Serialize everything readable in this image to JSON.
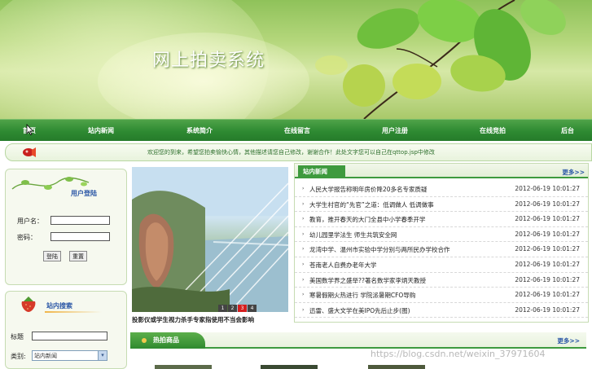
{
  "banner": {
    "title": "网上拍卖系统"
  },
  "nav": {
    "items": [
      {
        "label": "首页"
      },
      {
        "label": "站内新闻"
      },
      {
        "label": "系统简介"
      },
      {
        "label": "在线留言"
      },
      {
        "label": "用户注册"
      },
      {
        "label": "在线竞拍"
      },
      {
        "label": "后台"
      }
    ]
  },
  "marquee": {
    "text": "欢迎您的到来，希望您拍卖愉快心情，其他描述请您自己修改，谢谢合作！此处文字您可以自己在qttop.jsp中修改"
  },
  "login": {
    "title": "用户登陆",
    "username_label": "用户名：",
    "password_label": "密码：",
    "username_value": "",
    "password_value": "",
    "login_button": "登陆",
    "reset_button": "重置"
  },
  "search": {
    "title": "站内搜索",
    "title_label": "标题",
    "title_value": "",
    "category_label": "类别:",
    "category_selected": "站内新闻"
  },
  "slideshow": {
    "pages": [
      "1",
      "2",
      "3",
      "4"
    ],
    "active_page": "3",
    "caption": "投影仪或学生视力杀手专家指使用不当会影响"
  },
  "news": {
    "tab_label": "站内新闻",
    "more_label": "更多>>",
    "items": [
      {
        "title": "人民大学报告称明年房价降20多名专家质疑",
        "date": "2012-06-19 10:01:27"
      },
      {
        "title": "大学生村官的“先官”之道：低调做人 低调做事",
        "date": "2012-06-19 10:01:27"
      },
      {
        "title": "教育，推开春天的大门全县中小学春季开学",
        "date": "2012-06-19 10:01:27"
      },
      {
        "title": "幼儿园里学法生 师生共筑安全网",
        "date": "2012-06-19 10:01:27"
      },
      {
        "title": "龙湾中学、温州市实验中学分别与两所民办学校合作",
        "date": "2012-06-19 10:01:27"
      },
      {
        "title": "苍南老人自费办老年大学",
        "date": "2012-06-19 10:01:27"
      },
      {
        "title": "美国数学界之盛举??著名数学家李炳天教授",
        "date": "2012-06-19 10:01:27"
      },
      {
        "title": "寒暑假期火热进行 学院派暑期CFO导购",
        "date": "2012-06-19 10:01:27"
      },
      {
        "title": "迅雷、盛大文学在美IPO先后止步(图)",
        "date": "2012-06-19 10:01:27"
      }
    ]
  },
  "hot": {
    "tab_label": "热拍商品",
    "more_label": "更多>>"
  },
  "watermark": "https://blog.csdn.net/weixin_37971604",
  "colors": {
    "nav_green": "#2e8a32",
    "title_blue": "#2b57a6",
    "pager_active": "#d51e1e"
  }
}
